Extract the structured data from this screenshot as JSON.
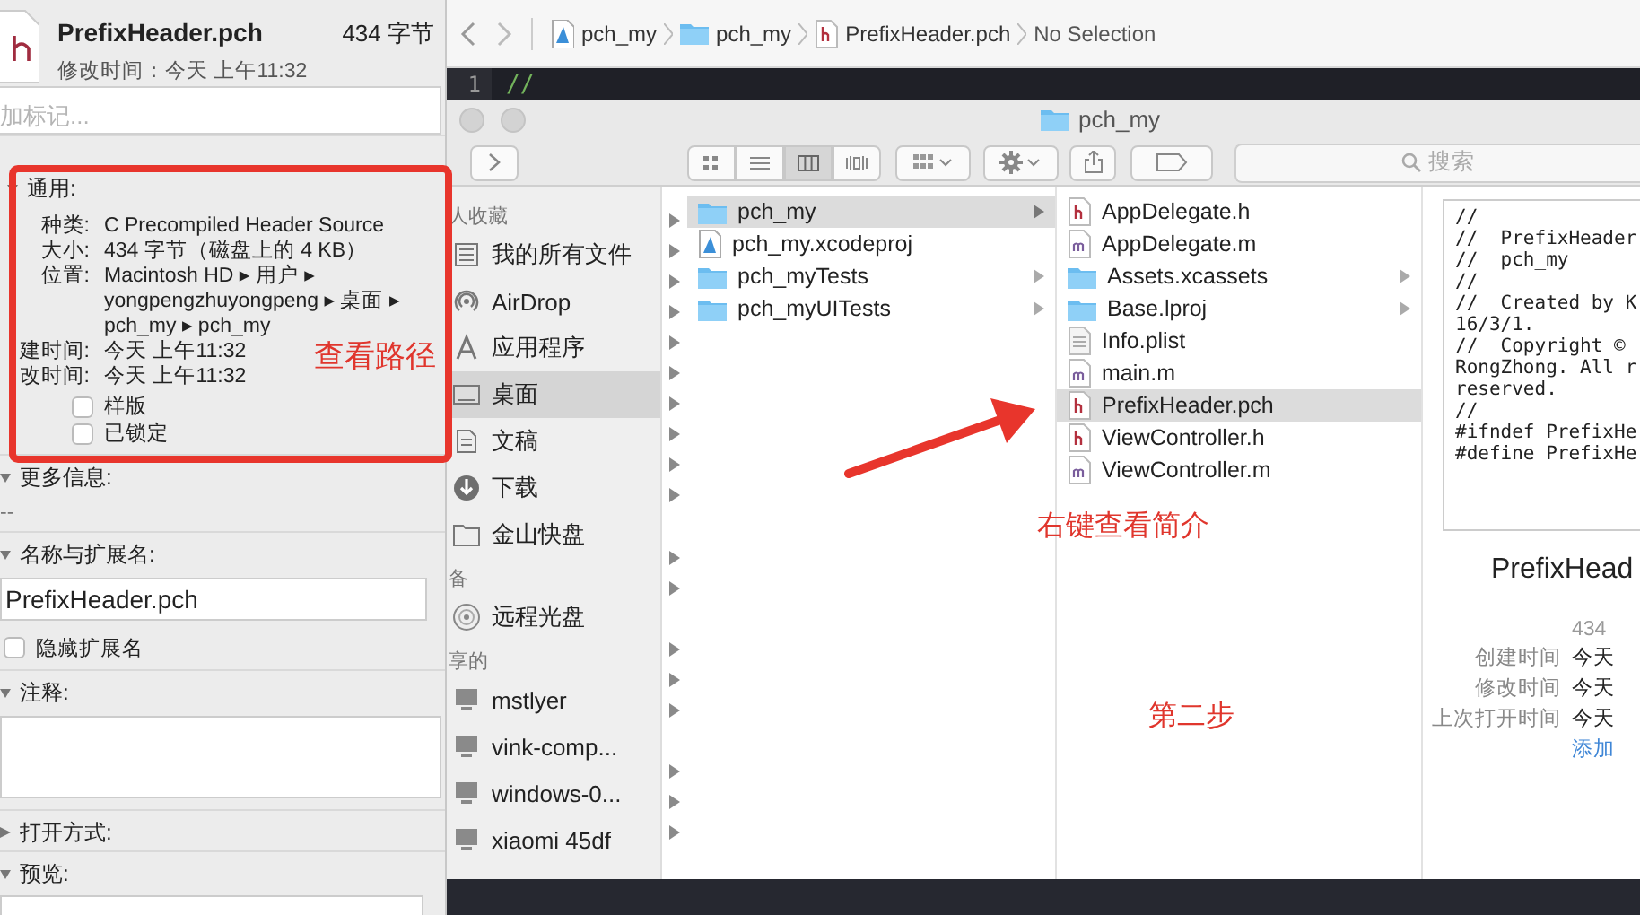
{
  "xcode": {
    "breadcrumb": [
      {
        "kind": "project",
        "label": "pch_my"
      },
      {
        "kind": "folder",
        "label": "pch_my"
      },
      {
        "kind": "header",
        "label": "PrefixHeader.pch"
      },
      {
        "kind": "none",
        "label": "No Selection"
      }
    ],
    "editor": {
      "line_number": "1",
      "code": "//"
    }
  },
  "finder": {
    "title": "pch_my",
    "search": {
      "placeholder": "搜索"
    },
    "view_modes": [
      {
        "kind": "icons",
        "selected": false
      },
      {
        "kind": "list",
        "selected": false
      },
      {
        "kind": "columns",
        "selected": true
      },
      {
        "kind": "coverflow",
        "selected": false
      }
    ],
    "sidebar": [
      {
        "heading": "人收藏",
        "items": [
          {
            "kind": "files",
            "label": "我的所有文件",
            "selected": false
          },
          {
            "kind": "airdrop",
            "label": "AirDrop",
            "selected": false
          },
          {
            "kind": "apps",
            "label": "应用程序",
            "selected": false
          },
          {
            "kind": "desktop",
            "label": "桌面",
            "selected": true
          },
          {
            "kind": "docs",
            "label": "文稿",
            "selected": false
          },
          {
            "kind": "download",
            "label": "下载",
            "selected": false
          },
          {
            "kind": "folder",
            "label": "金山快盘",
            "selected": false
          }
        ]
      },
      {
        "heading": "备",
        "items": [
          {
            "kind": "disc",
            "label": "远程光盘",
            "selected": false
          }
        ]
      },
      {
        "heading": "享的",
        "items": [
          {
            "kind": "computer",
            "label": "mstlyer",
            "selected": false
          },
          {
            "kind": "computer",
            "label": "vink-comp...",
            "selected": false
          },
          {
            "kind": "computer",
            "label": "windows-0...",
            "selected": false
          },
          {
            "kind": "computer",
            "label": "xiaomi 45df",
            "selected": false
          }
        ]
      }
    ],
    "columns": [
      {
        "items": [
          {
            "kind": "folder",
            "label": "pch_my",
            "selected": true,
            "has_children": true
          },
          {
            "kind": "project",
            "label": "pch_my.xcodeproj",
            "selected": false,
            "has_children": false
          },
          {
            "kind": "folder",
            "label": "pch_myTests",
            "selected": false,
            "has_children": true
          },
          {
            "kind": "folder",
            "label": "pch_myUITests",
            "selected": false,
            "has_children": true
          }
        ]
      },
      {
        "items": [
          {
            "kind": "header",
            "label": "AppDelegate.h",
            "selected": false,
            "has_children": false
          },
          {
            "kind": "source",
            "label": "AppDelegate.m",
            "selected": false,
            "has_children": false
          },
          {
            "kind": "folder",
            "label": "Assets.xcassets",
            "selected": false,
            "has_children": true
          },
          {
            "kind": "folder",
            "label": "Base.lproj",
            "selected": false,
            "has_children": true
          },
          {
            "kind": "plist",
            "label": "Info.plist",
            "selected": false,
            "has_children": false
          },
          {
            "kind": "source",
            "label": "main.m",
            "selected": false,
            "has_children": false
          },
          {
            "kind": "header",
            "label": "PrefixHeader.pch",
            "selected": true,
            "has_children": false
          },
          {
            "kind": "header",
            "label": "ViewController.h",
            "selected": false,
            "has_children": false
          },
          {
            "kind": "source",
            "label": "ViewController.m",
            "selected": false,
            "has_children": false
          }
        ]
      }
    ],
    "preview": {
      "code": [
        "//",
        "//  PrefixHeader",
        "//  pch_my",
        "//",
        "//  Created by K",
        "16/3/1.",
        "//  Copyright ©",
        "RongZhong. All r",
        "reserved.",
        "//",
        "#ifndef PrefixHe",
        "#define PrefixHe"
      ],
      "title": "PrefixHead",
      "size": "434",
      "details": [
        {
          "label": "创建时间",
          "value": "今天"
        },
        {
          "label": "修改时间",
          "value": "今天"
        },
        {
          "label": "上次打开时间",
          "value": "今天"
        }
      ],
      "link": "添加"
    }
  },
  "info_panel": {
    "file_name": "PrefixHeader.pch",
    "size": "434 字节",
    "modified": "修改时间：今天 上午11:32",
    "tags": {
      "placeholder": "加标记..."
    },
    "sections": [
      {
        "kind": "general",
        "title": "通用:",
        "expanded": true,
        "rows": [
          {
            "label": "种类:",
            "value": "C Precompiled Header Source"
          },
          {
            "label": "大小:",
            "value": "434 字节（磁盘上的 4 KB）"
          },
          {
            "label": "位置:",
            "value": "Macintosh HD ▸ 用户 ▸ yongpengzhuyongpeng ▸ 桌面 ▸ pch_my ▸ pch_my"
          },
          {
            "label": "建时间:",
            "value": "今天 上午11:32"
          },
          {
            "label": "改时间:",
            "value": "今天 上午11:32"
          }
        ],
        "checkboxes": [
          {
            "label": "样版",
            "checked": false
          },
          {
            "label": "已锁定",
            "checked": false
          }
        ]
      },
      {
        "kind": "text",
        "title": "更多信息:",
        "expanded": true,
        "text": "--"
      },
      {
        "kind": "name",
        "title": "名称与扩展名:",
        "expanded": true,
        "value": "PrefixHeader.pch",
        "checkboxes": [
          {
            "label": "隐藏扩展名",
            "checked": false
          }
        ]
      },
      {
        "kind": "comments",
        "title": "注释:",
        "expanded": true
      },
      {
        "title": "打开方式:",
        "expanded": false
      },
      {
        "kind": "preview",
        "title": "预览:",
        "expanded": true
      }
    ]
  },
  "annotations": {
    "path_note": "查看路径",
    "step_hint": "右键查看简介",
    "step_label": "第二步"
  }
}
